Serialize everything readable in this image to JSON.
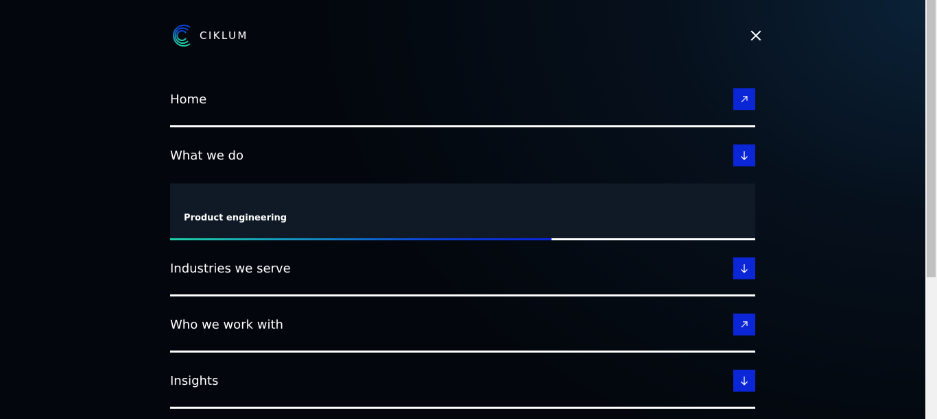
{
  "brand": {
    "name": "CIKLUM",
    "accent": "#0b26d6",
    "gradient_start": "#1fd1a5"
  },
  "header": {
    "close_icon": "close-icon"
  },
  "menu": {
    "items": [
      {
        "label": "Home",
        "icon": "arrow-up-right-icon"
      },
      {
        "label": "What we do",
        "icon": "arrow-down-icon",
        "submenu": {
          "items": [
            {
              "label": "Product engineering"
            }
          ],
          "progress": 0.652
        }
      },
      {
        "label": "Industries we serve",
        "icon": "arrow-down-icon"
      },
      {
        "label": "Who we work with",
        "icon": "arrow-up-right-icon"
      },
      {
        "label": "Insights",
        "icon": "arrow-down-icon"
      }
    ]
  }
}
